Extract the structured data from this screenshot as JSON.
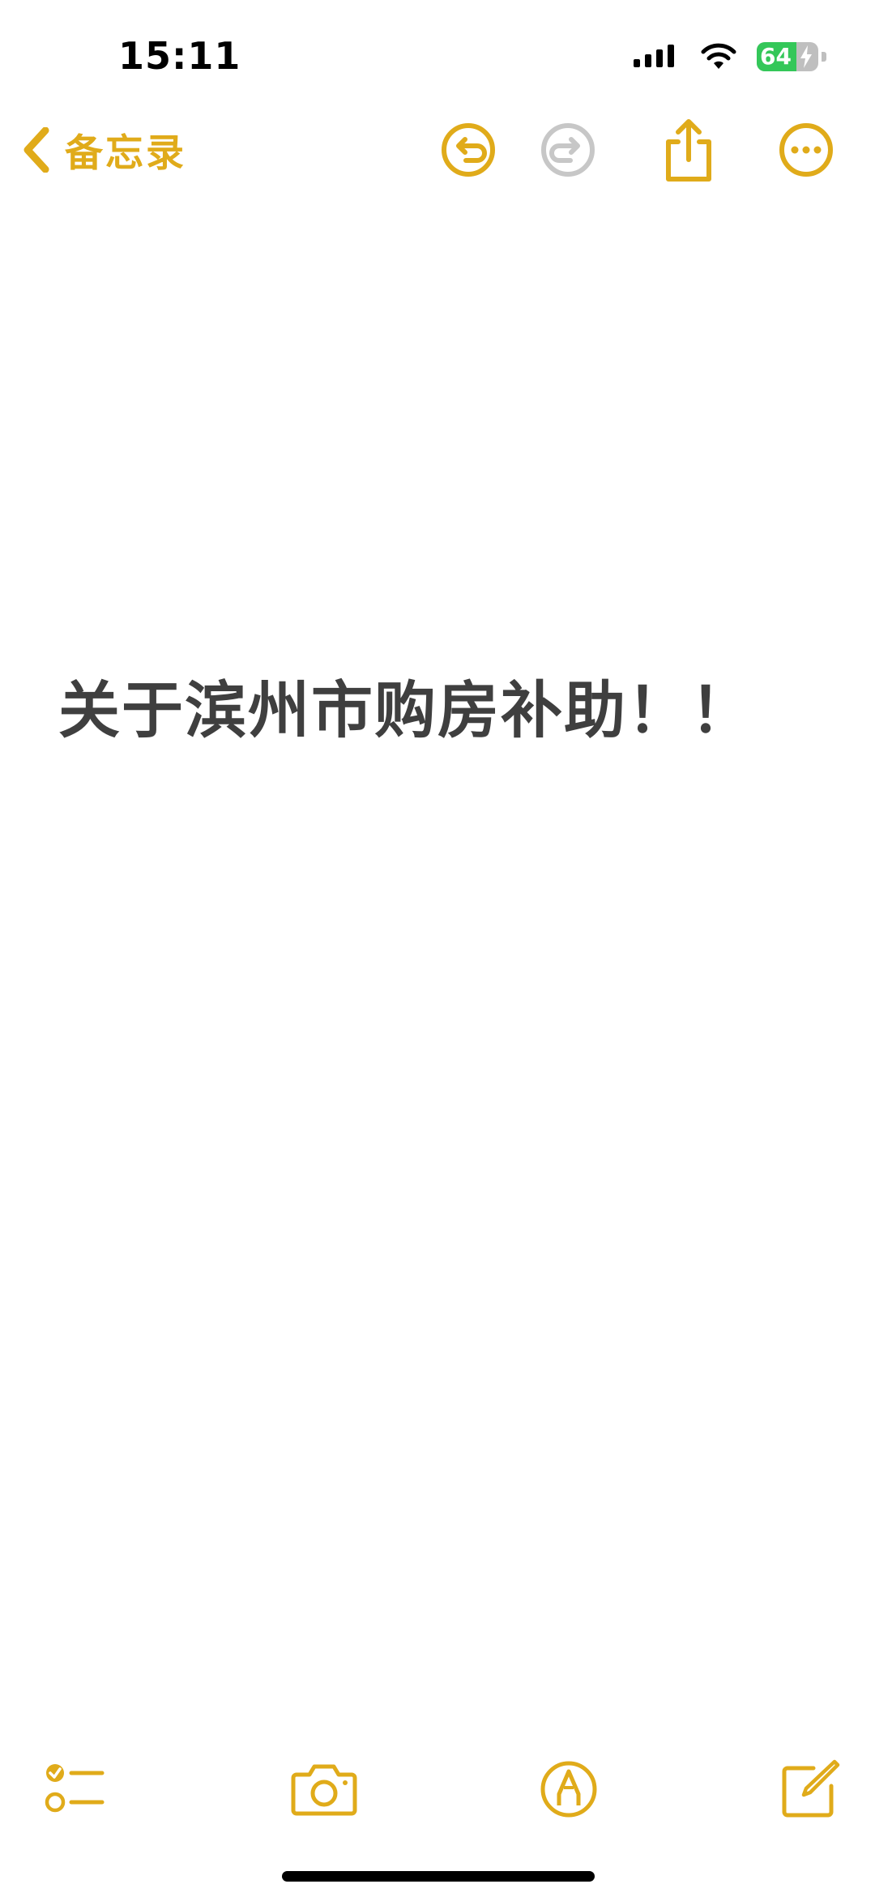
{
  "status_bar": {
    "time": "15:11",
    "battery_level": "64",
    "battery_fraction": 0.64,
    "signal_icon": "cellular-signal-icon",
    "wifi_icon": "wifi-icon",
    "charging_icon": "charging-bolt-icon"
  },
  "nav": {
    "back_label": "备忘录",
    "back_icon": "chevron-left-icon",
    "undo_icon": "undo-icon",
    "redo_icon": "redo-icon",
    "share_icon": "share-icon",
    "more_icon": "more-ellipsis-icon"
  },
  "note": {
    "title": "关于滨州市购房补助！！"
  },
  "toolbar": {
    "checklist_icon": "checklist-icon",
    "camera_icon": "camera-icon",
    "markup_icon": "markup-pen-icon",
    "compose_icon": "compose-icon"
  },
  "colors": {
    "accent": "#e0ab1a",
    "disabled": "#c7c7c7",
    "text": "#3f3f3f",
    "battery_green": "#34c759"
  }
}
